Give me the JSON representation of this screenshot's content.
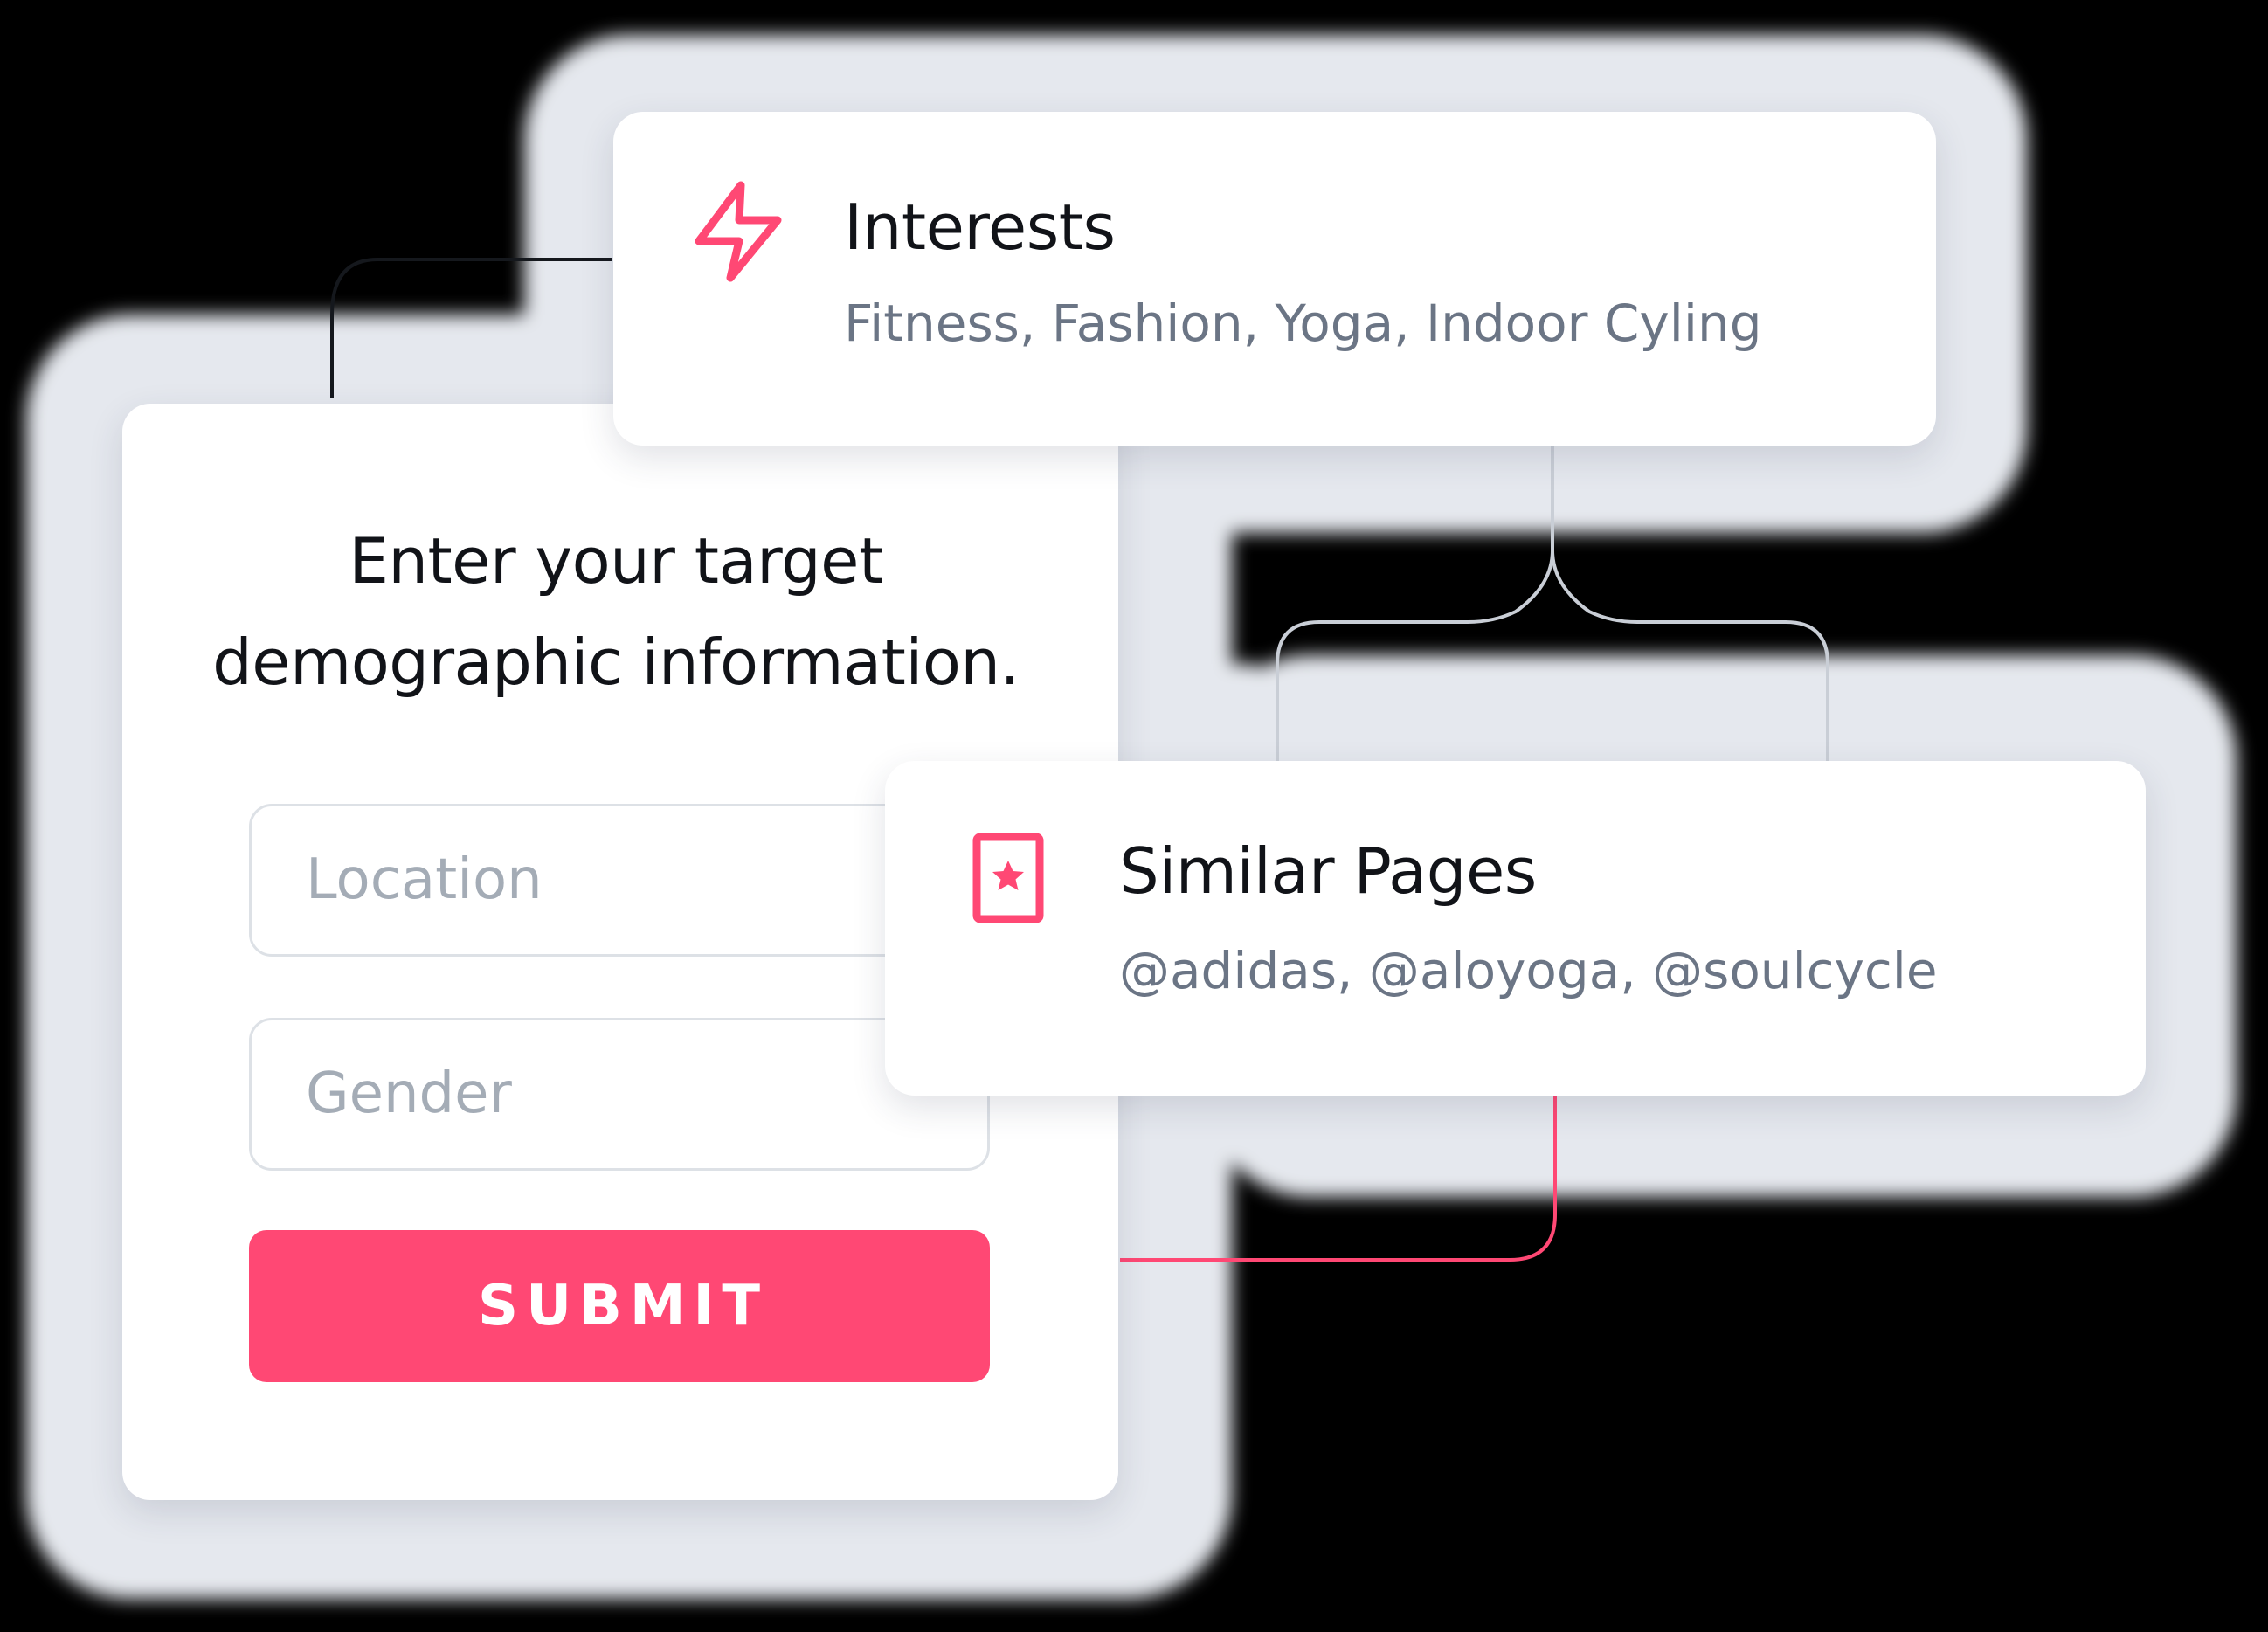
{
  "form": {
    "title": "Enter your target\ndemographic information.",
    "location_placeholder": "Location",
    "gender_placeholder": "Gender",
    "submit_label": "SUBMIT"
  },
  "interests": {
    "icon": "lightning-icon",
    "title": "Interests",
    "value": "Fitness, Fashion, Yoga, Indoor Cyling"
  },
  "similar_pages": {
    "icon": "star-bookmark-icon",
    "title": "Similar Pages",
    "value": "@adidas, @aloyoga, @soulcycle"
  },
  "colors": {
    "accent": "#ff4874",
    "backdrop": "#e5e8ee",
    "card": "#ffffff",
    "title_text": "#111318",
    "secondary_text": "#6b7585",
    "placeholder_text": "#a4acb6",
    "input_border": "#dde1e6"
  }
}
